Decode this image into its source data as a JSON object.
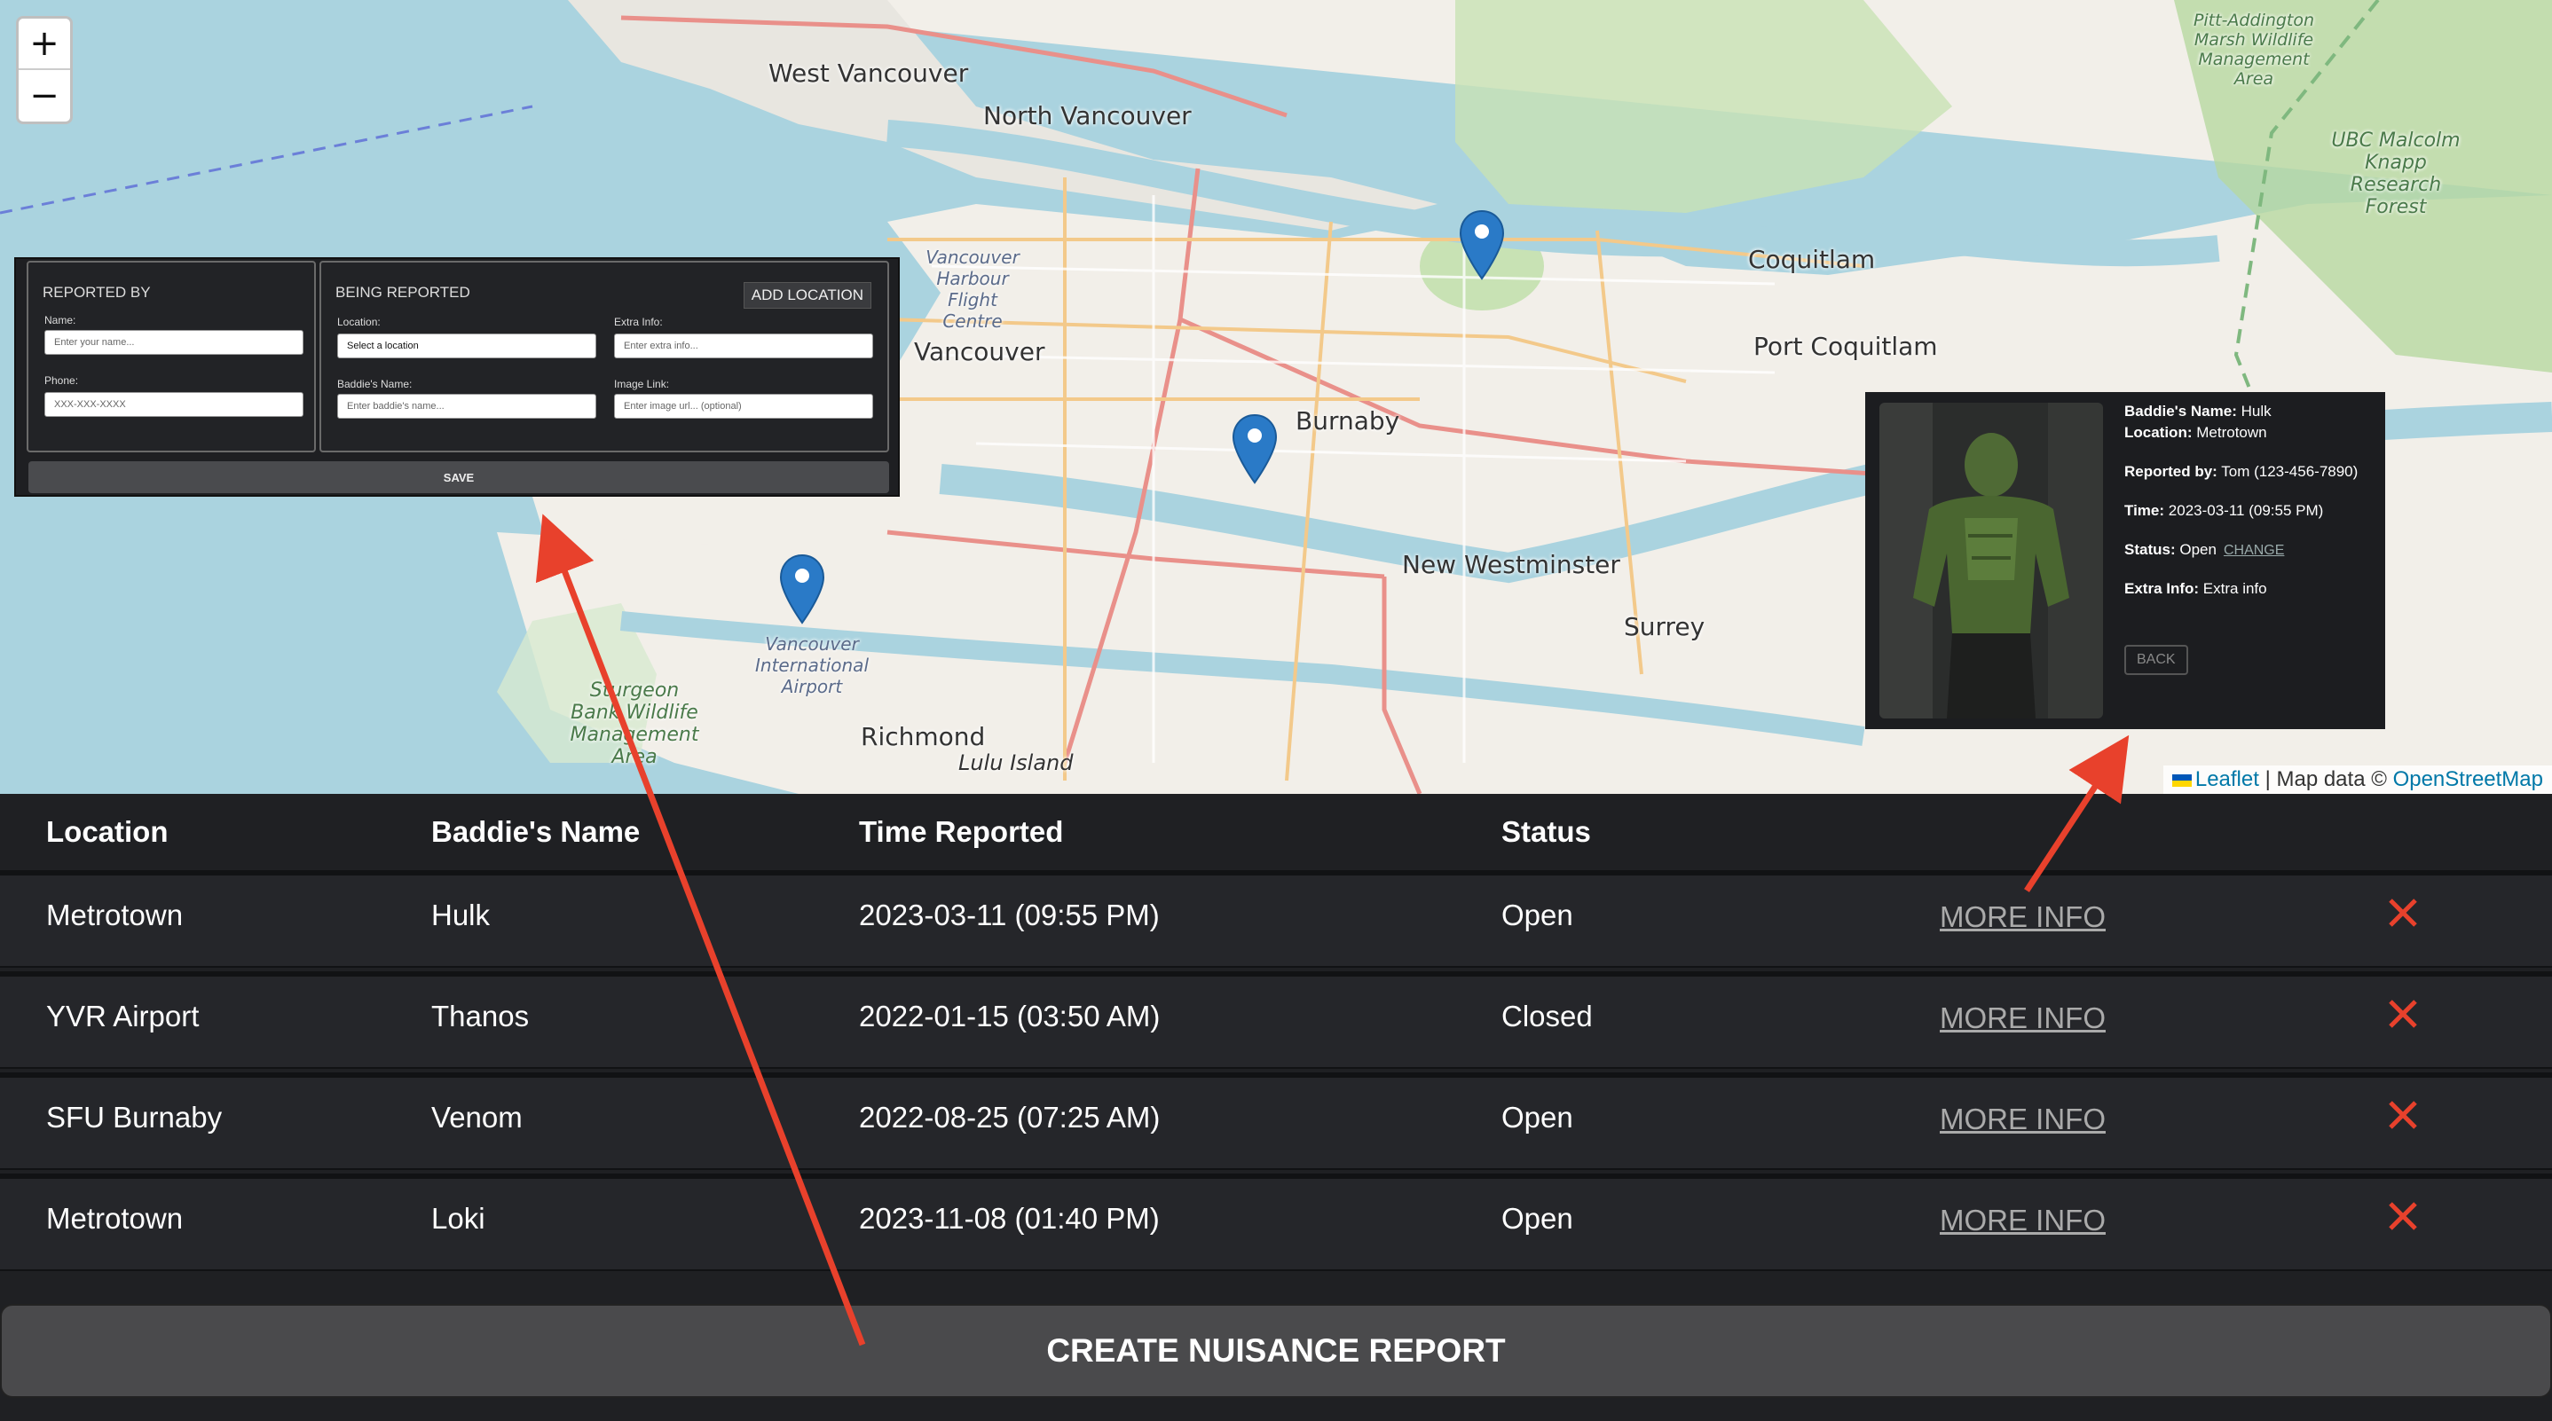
{
  "map": {
    "zoom_in": "+",
    "zoom_out": "−",
    "places": {
      "west_vancouver": "West Vancouver",
      "north_vancouver": "North Vancouver",
      "coquitlam": "Coquitlam",
      "port_coquitlam": "Port Coquitlam",
      "vancouver": "Vancouver",
      "burnaby": "Burnaby",
      "new_westminster": "New Westminster",
      "surrey": "Surrey",
      "richmond": "Richmond",
      "lulu_island": "Lulu Island",
      "airport": "Vancouver International Airport",
      "harbour": "Vancouver Harbour Flight Centre",
      "sturgeon": "Sturgeon Bank Wildlife Management Area",
      "pitt": "Pitt-Addington Marsh Wildlife Management Area",
      "ubc": "UBC Malcolm Knapp Research Forest"
    },
    "attribution": {
      "leaflet": "Leaflet",
      "separator": " | Map data © ",
      "osm": "OpenStreetMap"
    }
  },
  "form": {
    "reported_by": {
      "title": "REPORTED BY",
      "name_label": "Name:",
      "name_placeholder": "Enter your name...",
      "phone_label": "Phone:",
      "phone_placeholder": "XXX-XXX-XXXX"
    },
    "being_reported": {
      "title": "BEING REPORTED",
      "add_location": "ADD LOCATION",
      "location_label": "Location:",
      "location_value": "Select a location",
      "extra_label": "Extra Info:",
      "extra_placeholder": "Enter extra info...",
      "baddie_label": "Baddie's Name:",
      "baddie_placeholder": "Enter baddie's name...",
      "image_label": "Image Link:",
      "image_placeholder": "Enter image url... (optional)"
    },
    "save": "SAVE"
  },
  "info": {
    "name_label": "Baddie's Name:",
    "name": "Hulk",
    "location_label": "Location:",
    "location": "Metrotown",
    "reported_label": "Reported by:",
    "reported": "Tom (123-456-7890)",
    "time_label": "Time:",
    "time": "2023-03-11 (09:55 PM)",
    "status_label": "Status:",
    "status": "Open",
    "change": "CHANGE",
    "extra_label": "Extra Info:",
    "extra": "Extra info",
    "back": "BACK"
  },
  "table": {
    "headers": [
      "Location",
      "Baddie's Name",
      "Time Reported",
      "Status"
    ],
    "more_info": "MORE INFO",
    "rows": [
      {
        "location": "Metrotown",
        "name": "Hulk",
        "time": "2023-03-11 (09:55 PM)",
        "status": "Open"
      },
      {
        "location": "YVR Airport",
        "name": "Thanos",
        "time": "2022-01-15 (03:50 AM)",
        "status": "Closed"
      },
      {
        "location": "SFU Burnaby",
        "name": "Venom",
        "time": "2022-08-25 (07:25 AM)",
        "status": "Open"
      },
      {
        "location": "Metrotown",
        "name": "Loki",
        "time": "2023-11-08 (01:40 PM)",
        "status": "Open"
      }
    ]
  },
  "create_button": "CREATE NUISANCE REPORT",
  "colors": {
    "accent_red": "#e8412c",
    "pin_blue": "#2a7ac7",
    "panel_dark": "#1e1f22"
  }
}
